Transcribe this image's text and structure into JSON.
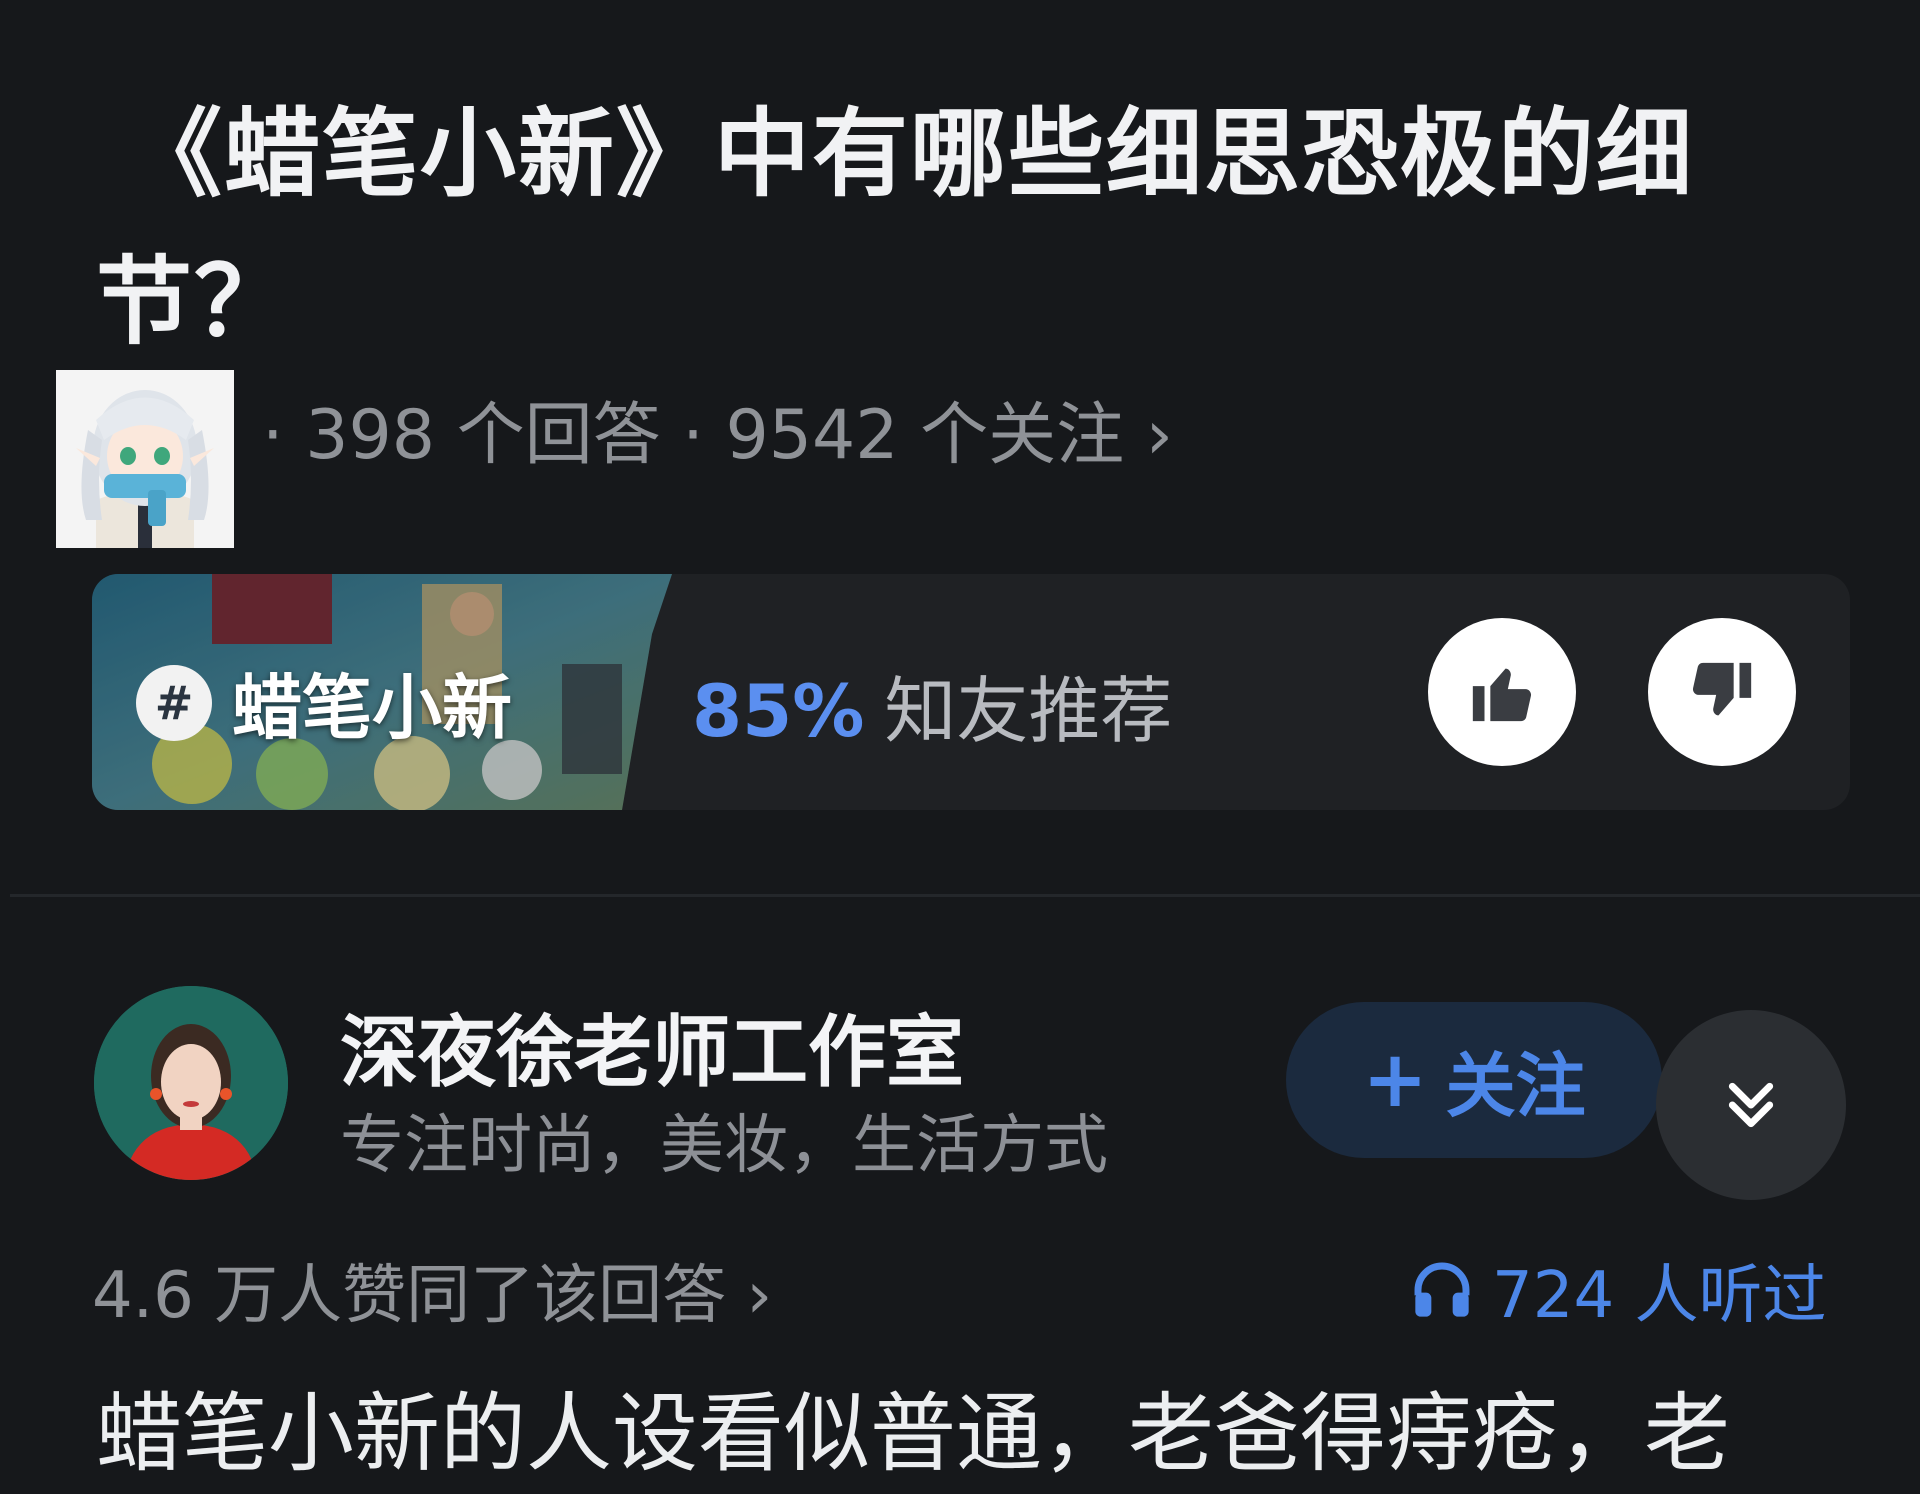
{
  "question": {
    "title_line1": "《蜡笔小新》中有哪些细思恐极的细",
    "title_line2": "节？",
    "meta": "· 398 个回答 · 9542 个关注 ›"
  },
  "topic": {
    "hash": "#",
    "name": "蜡笔小新",
    "percent": "85%",
    "recommend_label": "知友推荐",
    "like_icon": "thumbs-up-icon",
    "dislike_icon": "thumbs-down-icon"
  },
  "answer": {
    "author_name": "深夜徐老师工作室",
    "author_bio": "专注时尚，美妆，生活方式",
    "follow_plus": "+",
    "follow_label": "关注",
    "agree_text": "4.6 万人赞同了该回答 ›",
    "listen_text": "724 人听过",
    "body_preview": "蜡笔小新的人设看似普通，老爸得痔疮，老"
  },
  "colors": {
    "background": "#16181b",
    "accent_blue": "#4c86e8",
    "percent_blue": "#5b8ff0",
    "follow_bg": "#1b2a3e"
  }
}
